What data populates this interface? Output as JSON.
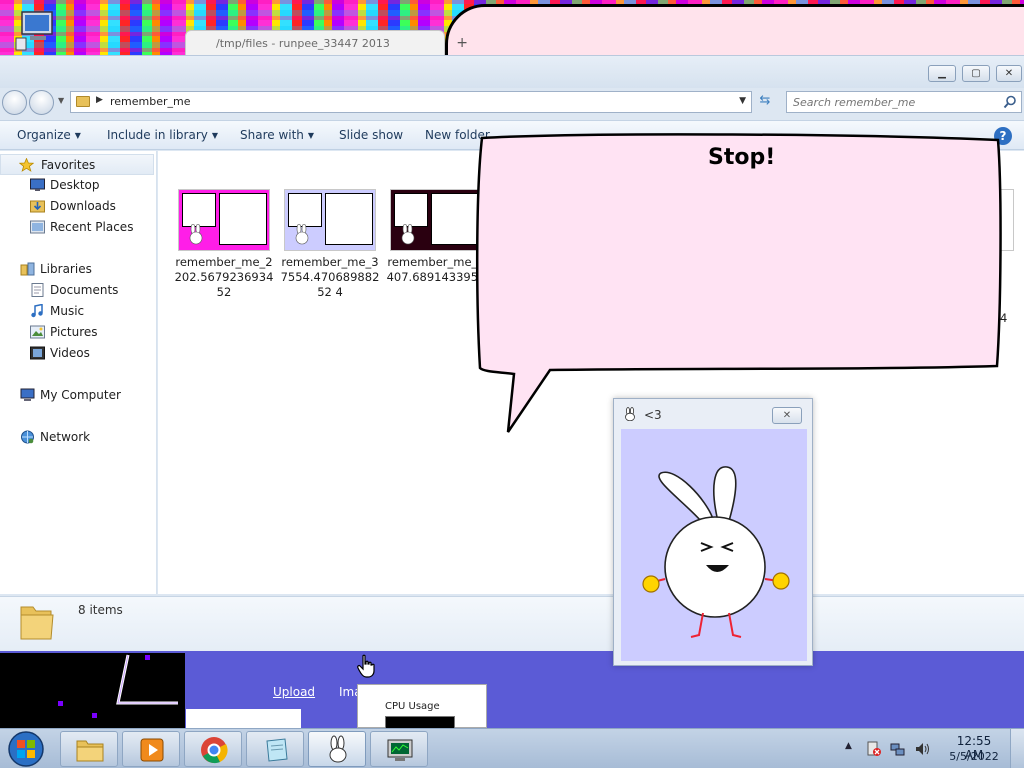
{
  "browser": {
    "tab_title": "/tmp/files - runpee_33447 2013"
  },
  "explorer": {
    "address": "remember_me",
    "search_placeholder": "Search remember_me",
    "toolbar": {
      "organize": "Organize",
      "include_in_library": "Include in library",
      "share_with": "Share with",
      "slide_show": "Slide show",
      "new_folder": "New folder"
    },
    "nav": {
      "favorites": "Favorites",
      "desktop": "Desktop",
      "downloads": "Downloads",
      "recent_places": "Recent Places",
      "libraries": "Libraries",
      "documents": "Documents",
      "music": "Music",
      "pictures": "Pictures",
      "videos": "Videos",
      "my_computer": "My Computer",
      "network": "Network"
    },
    "files": [
      {
        "name": "remember_me_2202.567923693452",
        "thumb_color": "#ff1ee8"
      },
      {
        "name": "remember_me_37554.47068988252 4",
        "thumb_color": "#ccccff"
      },
      {
        "name": "remember_me_8407.6891433950",
        "thumb_color": "#2a0010"
      }
    ],
    "partial_file_suffix": "4",
    "items_count": "8 items"
  },
  "webpage": {
    "upload_link": "Upload",
    "ima_link": "Ima",
    "cpu_label": "CPU Usage"
  },
  "speech_bubble": {
    "text": "Stop!"
  },
  "bunny_window": {
    "title": "<3",
    "close": "✕"
  },
  "taskbar": {
    "time": "12:55 AM",
    "date": "5/5/2022"
  }
}
